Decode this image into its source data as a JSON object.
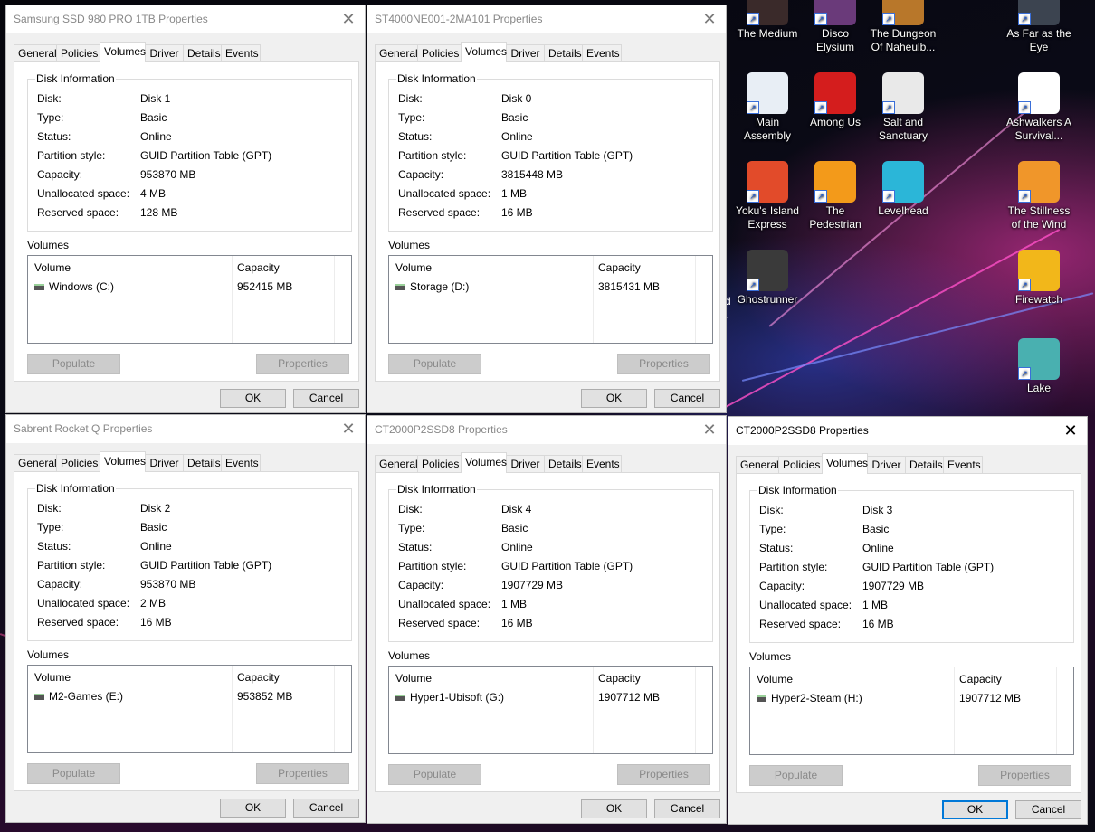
{
  "tabs": [
    "General",
    "Policies",
    "Volumes",
    "Driver",
    "Details",
    "Events"
  ],
  "labels": {
    "disk_information": "Disk Information",
    "disk": "Disk:",
    "type": "Type:",
    "status": "Status:",
    "partition_style": "Partition style:",
    "capacity": "Capacity:",
    "unallocated": "Unallocated space:",
    "reserved": "Reserved space:",
    "volumes": "Volumes",
    "col_volume": "Volume",
    "col_capacity": "Capacity",
    "populate": "Populate",
    "properties": "Properties",
    "ok": "OK",
    "cancel": "Cancel"
  },
  "dialogs": [
    {
      "title": "Samsung SSD 980 PRO 1TB Properties",
      "disk": "Disk 1",
      "type": "Basic",
      "status": "Online",
      "partition_style": "GUID Partition Table (GPT)",
      "capacity": "953870 MB",
      "unallocated": "4 MB",
      "reserved": "128 MB",
      "volume": "Windows (C:)",
      "volume_capacity": "952415 MB"
    },
    {
      "title": "ST4000NE001-2MA101 Properties",
      "disk": "Disk 0",
      "type": "Basic",
      "status": "Online",
      "partition_style": "GUID Partition Table (GPT)",
      "capacity": "3815448 MB",
      "unallocated": "1 MB",
      "reserved": "16 MB",
      "volume": "Storage (D:)",
      "volume_capacity": "3815431 MB"
    },
    {
      "title": "Sabrent Rocket Q Properties",
      "disk": "Disk 2",
      "type": "Basic",
      "status": "Online",
      "partition_style": "GUID Partition Table (GPT)",
      "capacity": "953870 MB",
      "unallocated": "2 MB",
      "reserved": "16 MB",
      "volume": "M2-Games (E:)",
      "volume_capacity": "953852 MB"
    },
    {
      "title": "CT2000P2SSD8 Properties",
      "disk": "Disk 4",
      "type": "Basic",
      "status": "Online",
      "partition_style": "GUID Partition Table (GPT)",
      "capacity": "1907729 MB",
      "unallocated": "1 MB",
      "reserved": "16 MB",
      "volume": "Hyper1-Ubisoft (G:)",
      "volume_capacity": "1907712 MB"
    },
    {
      "title": "CT2000P2SSD8 Properties",
      "disk": "Disk 3",
      "type": "Basic",
      "status": "Online",
      "partition_style": "GUID Partition Table (GPT)",
      "capacity": "1907729 MB",
      "unallocated": "1 MB",
      "reserved": "16 MB",
      "volume": "Hyper2-Steam (H:)",
      "volume_capacity": "1907712 MB"
    }
  ],
  "desktop_icons": [
    {
      "label": "The Medium",
      "icon": "the-medium-icon",
      "color": "#3a2a2a"
    },
    {
      "label": "Disco Elysium",
      "icon": "disco-elysium-icon",
      "color": "#6a3a7a"
    },
    {
      "label": "The Dungeon Of Naheulb...",
      "icon": "dungeon-naheulbeuk-icon",
      "color": "#b8772a"
    },
    {
      "label": "As Far as the Eye",
      "icon": "as-far-as-the-eye-icon",
      "color": "#3c4450"
    },
    {
      "label": "Main Assembly",
      "icon": "main-assembly-icon",
      "color": "#e8eef5"
    },
    {
      "label": "Among Us",
      "icon": "among-us-icon",
      "color": "#d41d1d"
    },
    {
      "label": "Salt and Sanctuary",
      "icon": "salt-and-sanctuary-icon",
      "color": "#e9e9e9"
    },
    {
      "label": "Ashwalkers A Survival...",
      "icon": "ashwalkers-icon",
      "color": "#ffffff"
    },
    {
      "label": "Yoku's Island Express",
      "icon": "yokus-island-icon",
      "color": "#e24b2a"
    },
    {
      "label": "The Pedestrian",
      "icon": "the-pedestrian-icon",
      "color": "#f39a1a"
    },
    {
      "label": "Levelhead",
      "icon": "levelhead-icon",
      "color": "#2bb6d8"
    },
    {
      "label": "The Stillness of the Wind",
      "icon": "stillness-of-the-wind-icon",
      "color": "#f0962a"
    },
    {
      "label": "Ghostrunner",
      "icon": "ghostrunner-icon",
      "color": "#3a3a3a"
    },
    {
      "label": "Firewatch",
      "icon": "firewatch-icon",
      "color": "#f2b71a"
    },
    {
      "label": "Lake",
      "icon": "lake-icon",
      "color": "#49b0b0"
    }
  ],
  "edge_fragment": "d\n."
}
